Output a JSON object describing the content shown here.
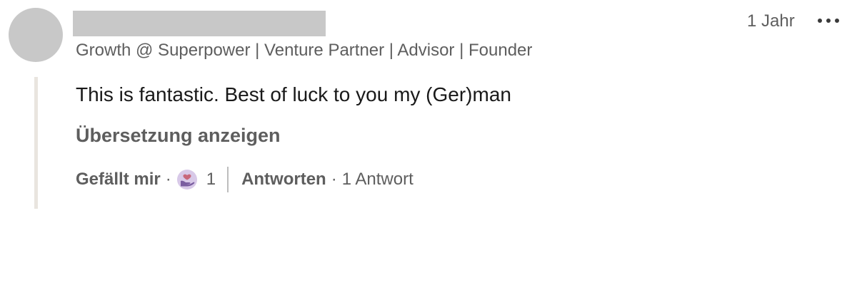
{
  "comment": {
    "headline": "Growth @ Superpower | Venture Partner | Advisor | Founder",
    "timestamp": "1 Jahr",
    "more_icon": "more-horizontal-icon",
    "text": "This is fantastic. Best of luck to you my (Ger)man",
    "translate_label": "Übersetzung anzeigen",
    "actions": {
      "like_label": "Gefällt mir",
      "separator": "·",
      "reaction_icon": "support-reaction-icon",
      "reaction_count": "1",
      "reply_label": "Antworten",
      "reply_count_label": "1 Antwort"
    }
  }
}
